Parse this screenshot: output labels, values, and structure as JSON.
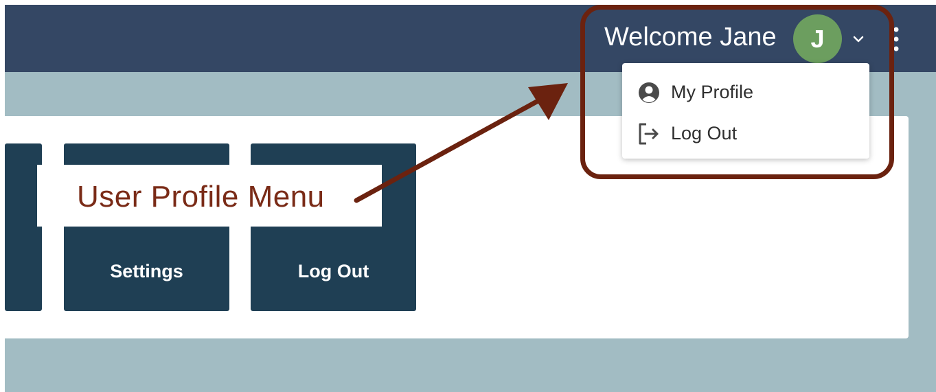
{
  "header": {
    "welcome_text": "Welcome Jane",
    "avatar_initial": "J",
    "avatar_color": "#6c9e5f",
    "bar_color": "#344764"
  },
  "user_menu": {
    "items": [
      {
        "label": "My Profile",
        "icon": "user-circle-icon"
      },
      {
        "label": "Log Out",
        "icon": "log-out-icon"
      }
    ]
  },
  "tiles": [
    {
      "label": ""
    },
    {
      "label": "Settings"
    },
    {
      "label": "Log Out"
    }
  ],
  "annotation": {
    "callout_text": "User Profile Menu",
    "accent_color": "#6b220f"
  },
  "colors": {
    "tile": "#1f3f54",
    "page_background": "#a2bcc3"
  }
}
